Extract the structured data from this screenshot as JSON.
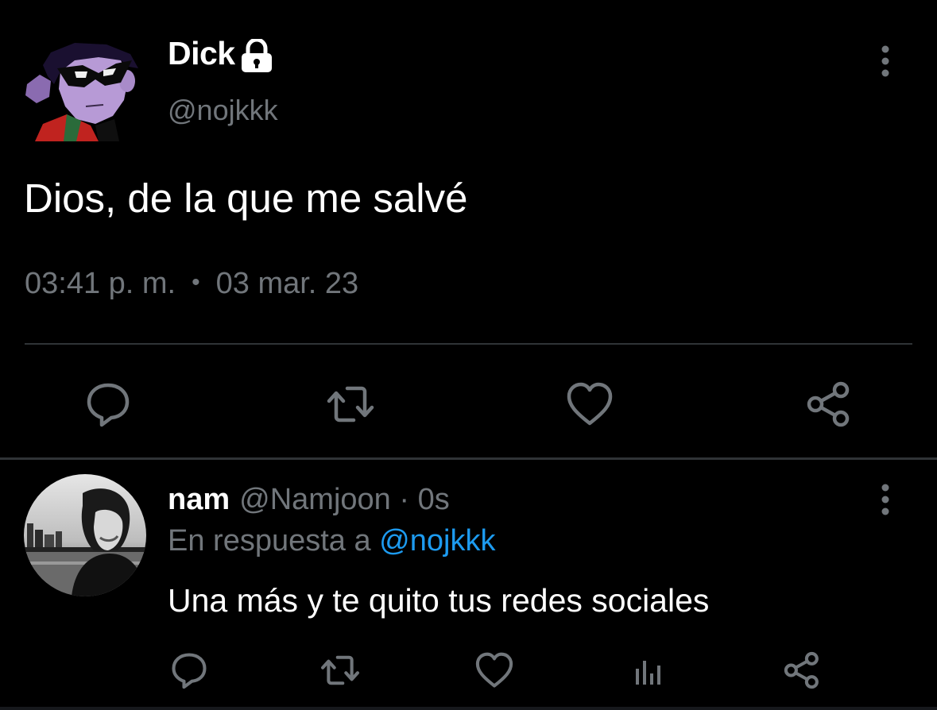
{
  "main_tweet": {
    "display_name": "Dick",
    "handle": "@nojkkk",
    "text": "Dios, de la que me salvé",
    "time": "03:41 p. m.",
    "separator": "•",
    "date": "03 mar. 23",
    "avatar_icon": "robin-avatar",
    "protected_icon": "lock-icon",
    "actions": [
      "reply-icon",
      "retweet-icon",
      "like-icon",
      "share-icon"
    ]
  },
  "reply": {
    "display_name": "nam",
    "handle": "@Namjoon",
    "time_sep": "·",
    "time": "0s",
    "reply_prefix": "En respuesta a",
    "reply_to": "@nojkkk",
    "text": "Una más y te quito tus redes sociales",
    "actions": [
      "reply-icon",
      "retweet-icon",
      "like-icon",
      "views-icon",
      "share-icon"
    ]
  },
  "colors": {
    "background": "#000000",
    "text_primary": "#ffffff",
    "text_secondary": "#71767b",
    "link": "#1d9bf0",
    "divider": "#2f3336",
    "icon": "#71767b"
  }
}
